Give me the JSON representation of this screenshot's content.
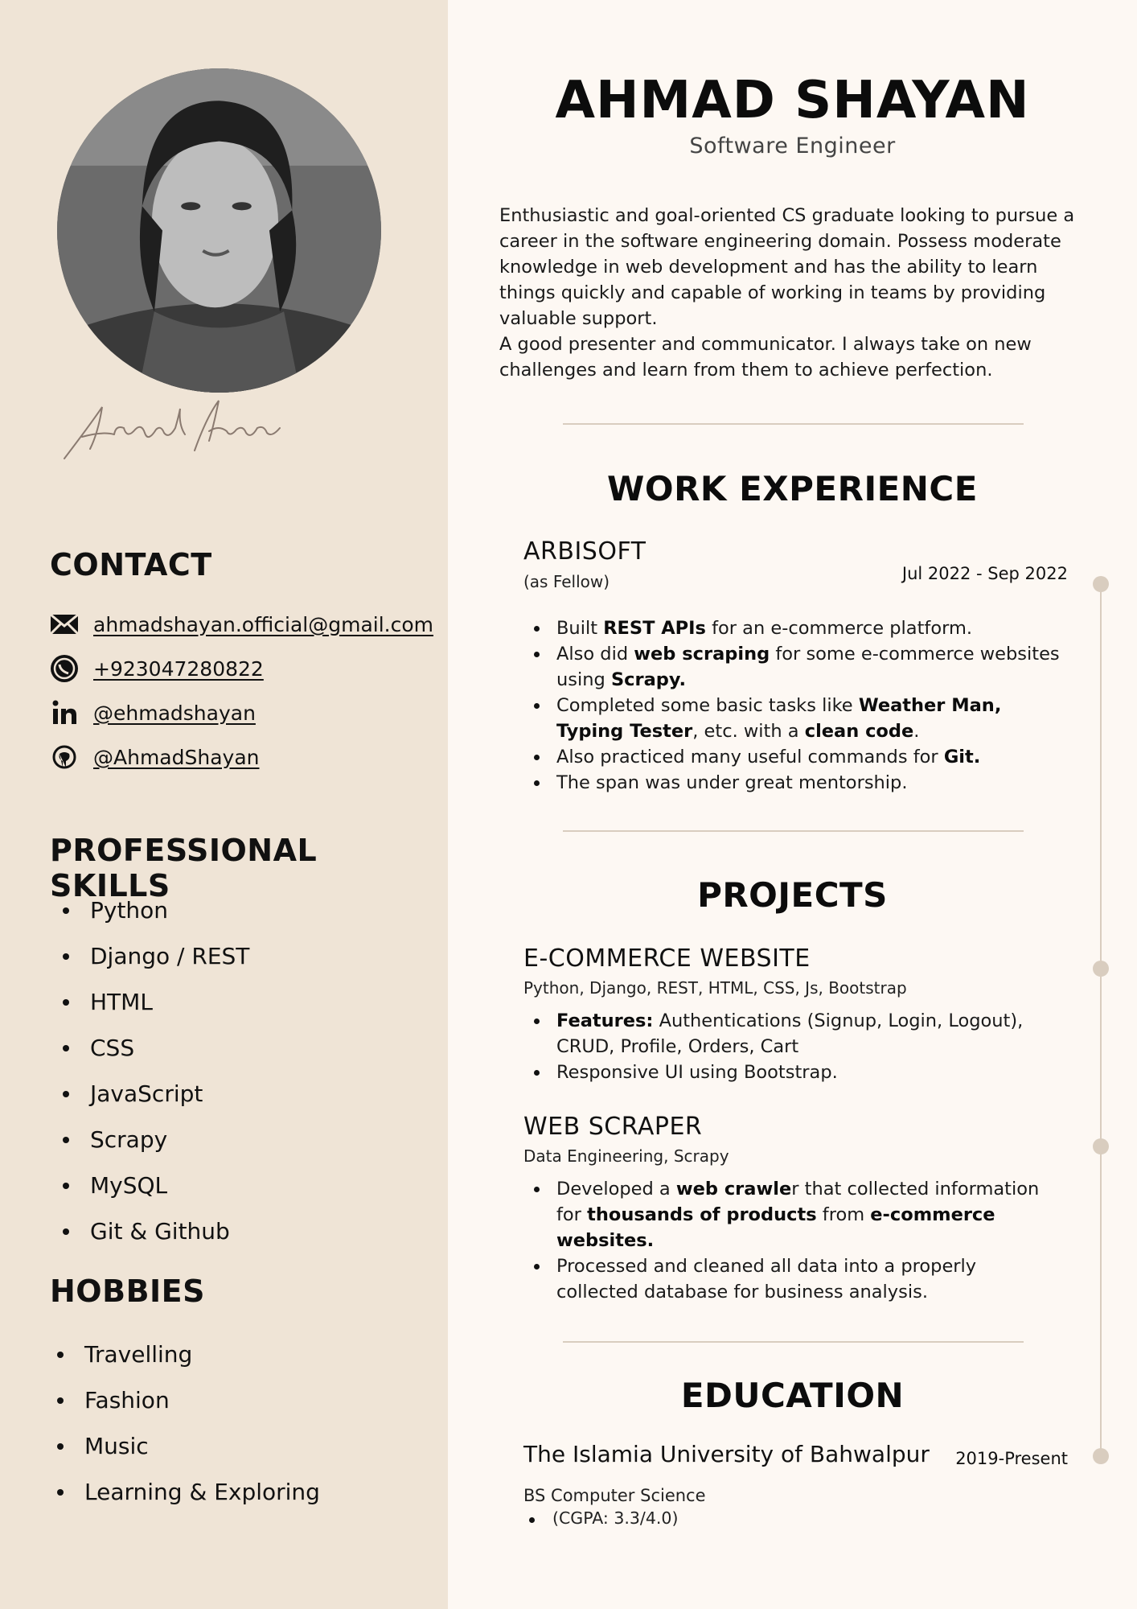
{
  "profile": {
    "name": "AHMAD SHAYAN",
    "role": "Software Engineer",
    "signature": "Ahmad Shayan"
  },
  "summary": [
    "Enthusiastic and goal-oriented CS graduate looking to pursue a career in the software engineering domain. Possess moderate knowledge in web development and has the ability to learn things quickly and capable of working in teams by providing valuable support.",
    "A good presenter and communicator. I always take on new challenges and learn from them to achieve perfection."
  ],
  "contact": {
    "heading": "CONTACT",
    "items": [
      {
        "icon": "envelope-icon",
        "text": "ahmadshayan.official@gmail.com"
      },
      {
        "icon": "whatsapp-icon",
        "text": "+923047280822"
      },
      {
        "icon": "linkedin-icon",
        "text": "@ehmadshayan"
      },
      {
        "icon": "github-icon",
        "text": "@AhmadShayan"
      }
    ]
  },
  "skills": {
    "heading": "PROFESSIONAL SKILLS",
    "items": [
      "Python",
      "Django / REST",
      "HTML",
      "CSS",
      "JavaScript",
      "Scrapy",
      "MySQL",
      "Git & Github"
    ]
  },
  "hobbies": {
    "heading": "HOBBIES",
    "items": [
      "Travelling",
      "Fashion",
      "Music",
      "Learning & Exploring"
    ]
  },
  "work": {
    "heading": "WORK EXPERIENCE",
    "company": "ARBISOFT",
    "position": "(as Fellow)",
    "dates": "Jul 2022 - Sep 2022",
    "bullets": [
      [
        {
          "t": "Built "
        },
        {
          "t": "REST APIs",
          "b": true
        },
        {
          "t": " for an e-commerce platform."
        }
      ],
      [
        {
          "t": "Also did "
        },
        {
          "t": "web scraping",
          "b": true
        },
        {
          "t": " for some e-commerce websites using "
        },
        {
          "t": "Scrapy.",
          "b": true
        }
      ],
      [
        {
          "t": "Completed some basic tasks like "
        },
        {
          "t": "Weather Man, Typing Tester",
          "b": true
        },
        {
          "t": ", etc. with a "
        },
        {
          "t": "clean code",
          "b": true
        },
        {
          "t": "."
        }
      ],
      [
        {
          "t": "Also practiced many useful commands for "
        },
        {
          "t": "Git.",
          "b": true
        }
      ],
      [
        {
          "t": "The span was under great mentorship."
        }
      ]
    ]
  },
  "projects": {
    "heading": "PROJECTS",
    "items": [
      {
        "title": "E-COMMERCE WEBSITE",
        "tech": "Python, Django, REST, HTML, CSS, Js, Bootstrap",
        "bullets": [
          [
            {
              "t": "Features:",
              "b": true
            },
            {
              "t": " Authentications (Signup, Login, Logout), CRUD, Profile, Orders, Cart"
            }
          ],
          [
            {
              "t": "Responsive UI using Bootstrap."
            }
          ]
        ]
      },
      {
        "title": "WEB SCRAPER",
        "tech": "Data Engineering, Scrapy",
        "bullets": [
          [
            {
              "t": "Developed a "
            },
            {
              "t": "web crawle",
              "b": true
            },
            {
              "t": "r that collected information for "
            },
            {
              "t": "thousands of products",
              "b": true
            },
            {
              "t": " from "
            },
            {
              "t": "e-commerce websites.",
              "b": true
            }
          ],
          [
            {
              "t": "Processed and cleaned all data into a properly collected database for business analysis."
            }
          ]
        ]
      }
    ]
  },
  "education": {
    "heading": "EDUCATION",
    "school": "The Islamia University of Bahwalpur",
    "years": "2019-Present",
    "degree": "BS Computer Science",
    "details": [
      "(CGPA: 3.3/4.0)"
    ]
  },
  "colors": {
    "sidebar_bg": "#efe4d6",
    "page_bg": "#fdf8f3",
    "accent_line": "#d9cdbf",
    "text": "#111111"
  }
}
